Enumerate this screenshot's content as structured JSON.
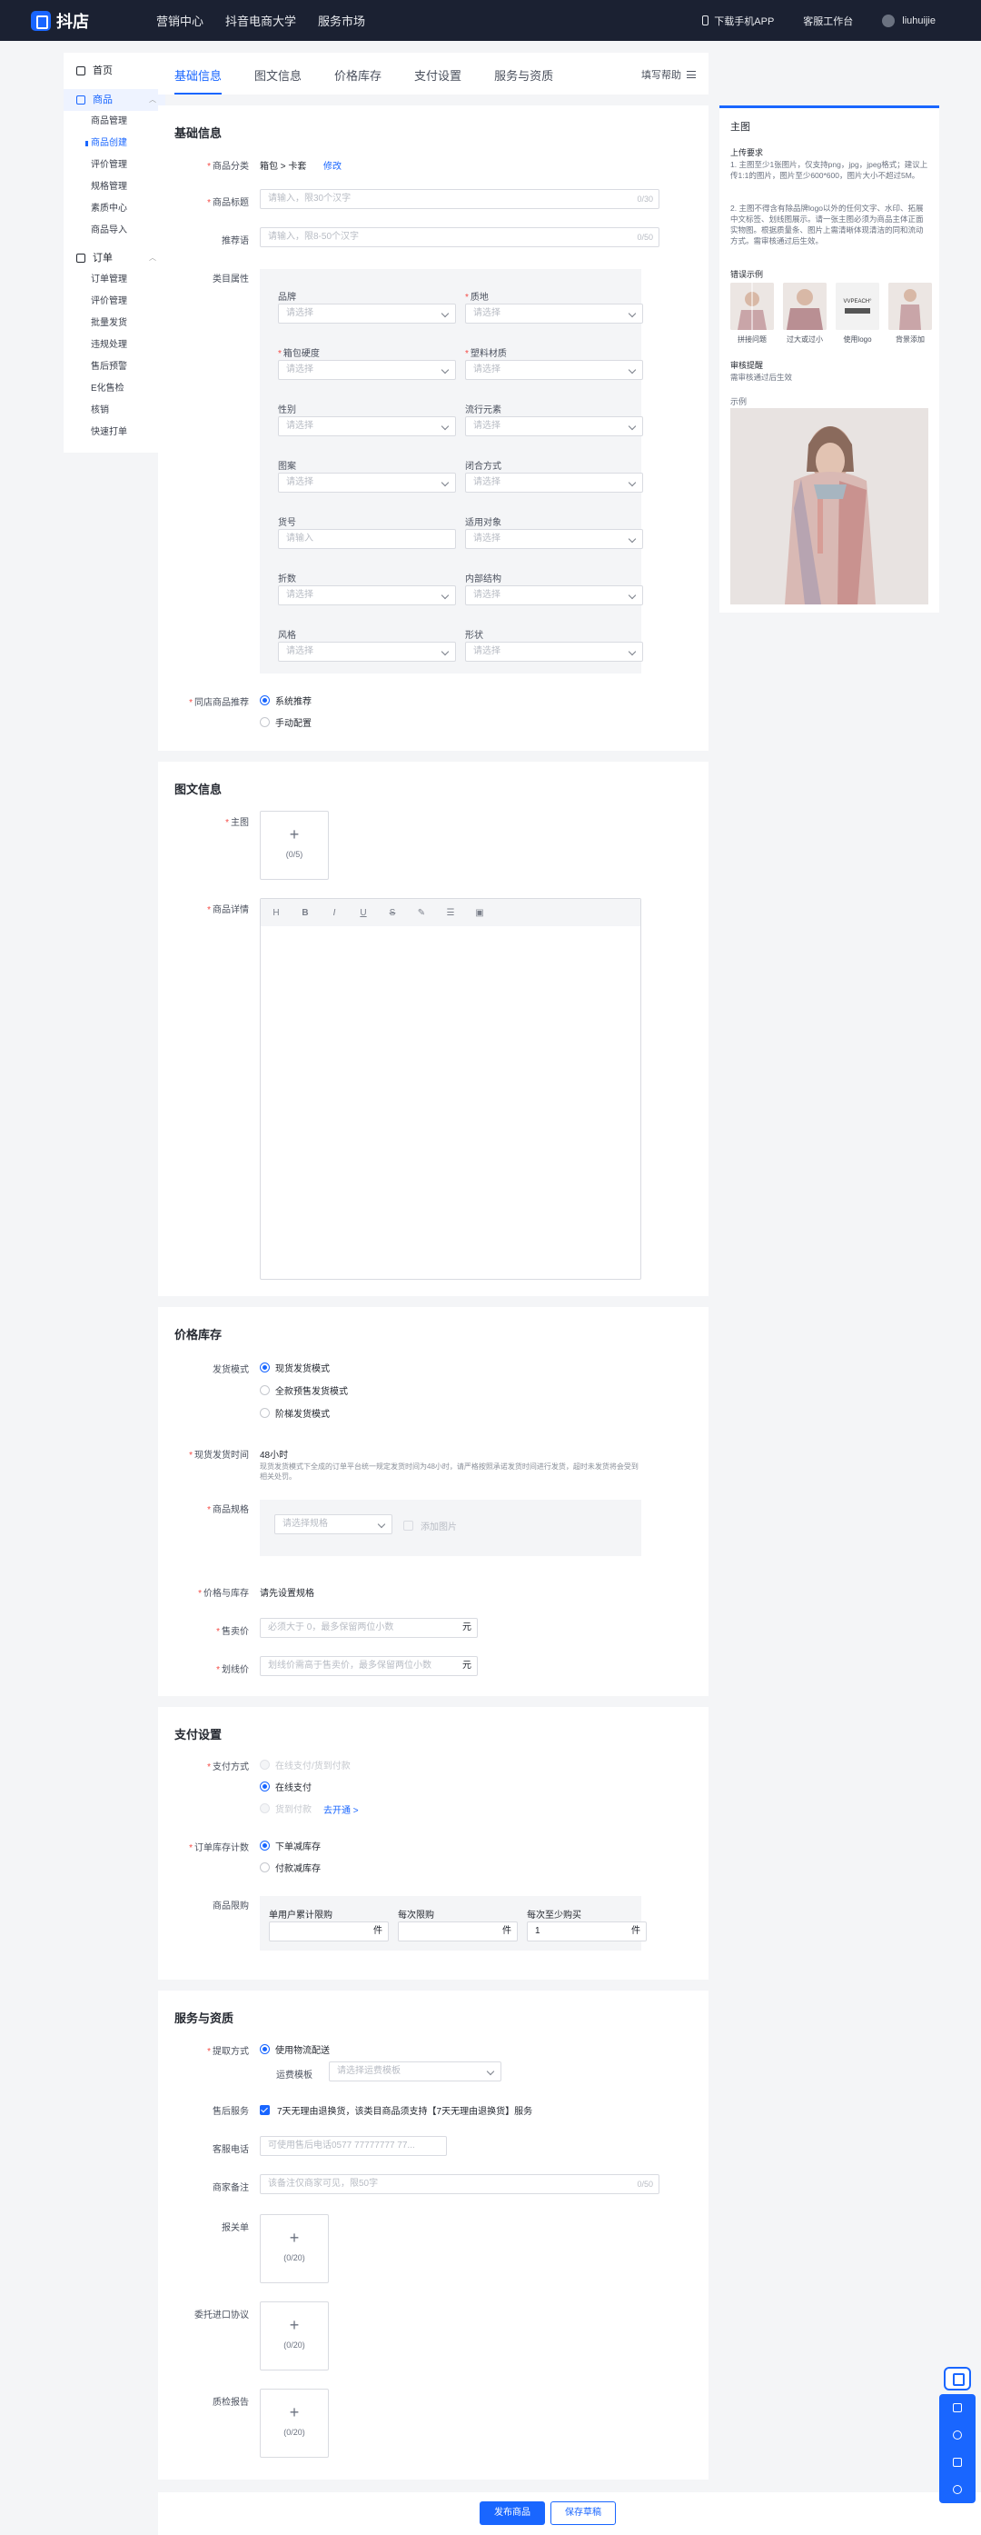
{
  "topbar": {
    "logo_text": "抖店",
    "nav": [
      "营销中心",
      "抖音电商大学",
      "服务市场"
    ],
    "download_app": "下载手机APP",
    "service_desk": "客服工作台",
    "username": "liuhuijie"
  },
  "sidebar": {
    "home": "首页",
    "goods": "商品",
    "goods_items": [
      "商品管理",
      "商品创建",
      "评价管理",
      "规格管理",
      "素质中心",
      "商品导入"
    ],
    "orders": "订单",
    "order_items": [
      "订单管理",
      "评价管理",
      "批量发货",
      "违规处理",
      "售后预警",
      "E化售检",
      "核销",
      "快速打单"
    ]
  },
  "tabs": [
    "基础信息",
    "图文信息",
    "价格库存",
    "支付设置",
    "服务与资质"
  ],
  "fill_help": "填写帮助",
  "basic": {
    "title": "基础信息",
    "category_label": "商品分类",
    "category_value": "箱包 > 卡套",
    "category_edit": "修改",
    "title_label": "商品标题",
    "title_placeholder": "请输入，限30个汉字",
    "title_count": "0/30",
    "recommend_label": "推荐语",
    "recommend_placeholder": "请输入，限8-50个汉字",
    "recommend_count": "0/50",
    "attr_label": "类目属性",
    "attrs": [
      {
        "label": "品牌",
        "required": false,
        "placeholder": "请选择"
      },
      {
        "label": "质地",
        "required": true,
        "placeholder": "请选择"
      },
      {
        "label": "箱包硬度",
        "required": true,
        "placeholder": "请选择"
      },
      {
        "label": "塑料材质",
        "required": true,
        "placeholder": "请选择"
      },
      {
        "label": "性别",
        "required": false,
        "placeholder": "请选择"
      },
      {
        "label": "流行元素",
        "required": false,
        "placeholder": "请选择"
      },
      {
        "label": "图案",
        "required": false,
        "placeholder": "请选择"
      },
      {
        "label": "闭合方式",
        "required": false,
        "placeholder": "请选择"
      },
      {
        "label": "货号",
        "required": false,
        "placeholder": "请输入"
      },
      {
        "label": "适用对象",
        "required": false,
        "placeholder": "请选择"
      },
      {
        "label": "折数",
        "required": false,
        "placeholder": "请选择"
      },
      {
        "label": "内部结构",
        "required": false,
        "placeholder": "请选择"
      },
      {
        "label": "风格",
        "required": false,
        "placeholder": "请选择"
      },
      {
        "label": "形状",
        "required": false,
        "placeholder": "请选择"
      }
    ],
    "same_recommend_label": "同店商品推荐",
    "same_recommend_options": [
      "系统推荐",
      "手动配置"
    ]
  },
  "media": {
    "title": "图文信息",
    "main_image_label": "主图",
    "main_image_count": "(0/5)",
    "detail_label": "商品详情",
    "toolbar": [
      "H",
      "B",
      "I",
      "U",
      "S",
      "✎",
      "☰",
      "▣"
    ]
  },
  "price": {
    "title": "价格库存",
    "ship_mode_label": "发货模式",
    "ship_modes": [
      "现货发货模式",
      "全款预售发货模式",
      "阶梯发货模式"
    ],
    "ship_time_label": "现货发货时间",
    "ship_time_value": "48小时",
    "ship_time_note": "现货发货模式下全成的订单平台统一规定发货时间为48小时，请严格按照承诺发货时间进行发货，超时未发货将会受到相关处罚。",
    "spec_label": "商品规格",
    "spec_placeholder": "请选择规格",
    "spec_add_image": "添加图片",
    "stock_label": "价格与库存",
    "stock_value": "请先设置规格",
    "sale_price_label": "售卖价",
    "sale_price_placeholder": "必须大于 0，最多保留两位小数",
    "sale_price_unit": "元",
    "strike_price_label": "划线价",
    "strike_price_placeholder": "划线价需高于售卖价，最多保留两位小数",
    "strike_price_unit": "元"
  },
  "pay": {
    "title": "支付设置",
    "pay_method_label": "支付方式",
    "pay_methods": [
      "在线支付/货到付款",
      "在线支付",
      "货到付款"
    ],
    "open_link": "去开通 >",
    "stock_count_label": "订单库存计数",
    "stock_counts": [
      "下单减库存",
      "付款减库存"
    ],
    "limit_label": "商品限购",
    "limit_cols": [
      "单用户累计限购",
      "每次限购",
      "每次至少购买"
    ],
    "limit_values": [
      "",
      "",
      "1"
    ],
    "limit_unit": "件"
  },
  "service": {
    "title": "服务与资质",
    "pickup_label": "提取方式",
    "pickup_option": "使用物流配送",
    "freight_label": "运费模板",
    "freight_placeholder": "请选择运费模板",
    "after_sale_label": "售后服务",
    "after_sale_text": "7天无理由退换货，该类目商品须支持【7天无理由退换货】服务",
    "phone_label": "客服电话",
    "phone_placeholder": "可使用售后电话0577 77777777 77...",
    "remark_label": "商家备注",
    "remark_placeholder": "该备注仅商家可见，限50字",
    "remark_count": "0/50",
    "customs_label": "报关单",
    "customs_count": "(0/20)",
    "import_label": "委托进口协议",
    "import_count": "(0/20)",
    "quality_label": "质检报告",
    "quality_count": "(0/20)"
  },
  "right_panel": {
    "title": "主图",
    "upload_req_title": "上传要求",
    "upload_req": [
      "1. 主图至少1张图片，仅支持png，jpg，jpeg格式；建议上传1:1的图片，图片至少600*600，图片大小不超过5M。",
      "2. 主图不得含有除品牌logo以外的任何文字、水印、拓展中文标签、划线图展示。请一张主图必须为商品主体正面实物图。根据质量条、图片上需清晰体现清洁的同和流动方式。需审核通过后生效。"
    ],
    "bad_examples_title": "错误示例",
    "bad_examples": [
      "拼接问题",
      "过大或过小",
      "使用logo",
      "背景添加"
    ],
    "review_title": "审核提醒",
    "review_text": "需审核通过后生效",
    "example_title": "示例"
  },
  "bottom": {
    "publish": "发布商品",
    "save_draft": "保存草稿"
  }
}
